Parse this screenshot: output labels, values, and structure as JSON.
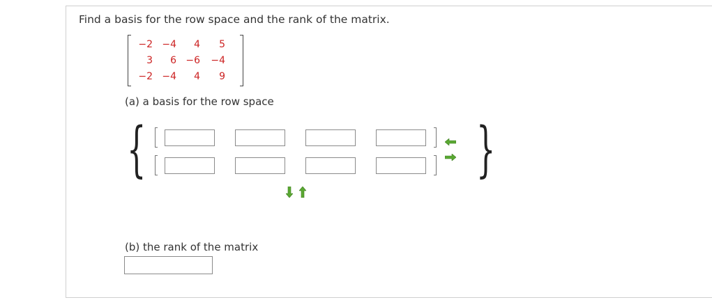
{
  "question": "Find a basis for the row space and the rank of the matrix.",
  "matrix": [
    [
      "−2",
      "−4",
      "4",
      "5"
    ],
    [
      "3",
      "6",
      "−6",
      "−4"
    ],
    [
      "−2",
      "−4",
      "4",
      "9"
    ]
  ],
  "part_a_label": "(a) a basis for the row space",
  "part_b_label": "(b) the rank of the matrix",
  "set_braces": {
    "open": "{",
    "close": "}"
  },
  "basis_rows": [
    {
      "values": [
        "",
        "",
        "",
        ""
      ]
    },
    {
      "values": [
        "",
        "",
        "",
        ""
      ]
    }
  ],
  "rank_value": "",
  "colors": {
    "matrix_entries": "#cc2222",
    "arrow_green": "#5aa832"
  },
  "icons": [
    "remove-vector-arrow-icon",
    "add-vector-arrow-icon",
    "remove-row-arrow-icon",
    "add-row-arrow-icon"
  ]
}
